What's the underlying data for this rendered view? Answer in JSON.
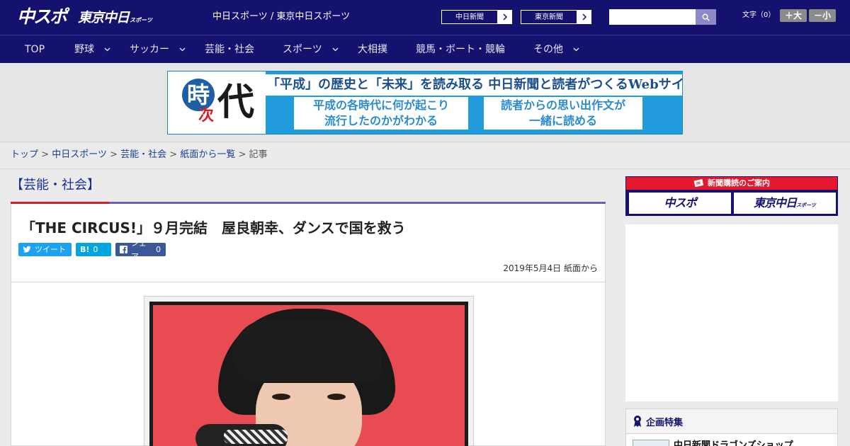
{
  "header": {
    "logo_chuspo": "中スポ",
    "logo_tokyo": "東京中日",
    "logo_tokyo_small": "スポーツ",
    "site_title": "中日スポーツ / 東京中日スポーツ",
    "btn_chunichi": "中日新聞",
    "btn_tokyo": "東京新聞",
    "search_placeholder": "",
    "font_label": "文字（0）",
    "font_large": "＋大",
    "font_small": "－小"
  },
  "nav": {
    "items": [
      {
        "label": "TOP"
      },
      {
        "label": "野球"
      },
      {
        "label": "サッカー"
      },
      {
        "label": "芸能・社会"
      },
      {
        "label": "スポーツ"
      },
      {
        "label": "大相撲"
      },
      {
        "label": "競馬・ボート・競輪"
      },
      {
        "label": "その他"
      }
    ]
  },
  "banner": {
    "logo_ji": "時",
    "logo_tsugi": "次",
    "logo_dai": "代",
    "headline": "「平成」の歴史と「未来」を読み取る 中日新聞と読者がつくるWebサイト",
    "box1_line1": "平成の各時代に何が起こり",
    "box1_line2": "流行したのかがわかる",
    "box2_line1": "読者からの思い出作文が",
    "box2_line2": "一緒に読める"
  },
  "breadcrumb": {
    "items": [
      "トップ",
      "中日スポーツ",
      "芸能・社会",
      "紙面から一覧"
    ],
    "current": "記事",
    "sep": ">"
  },
  "article": {
    "category": "【芸能・社会】",
    "title": "「THE CIRCUS!」９月完結　屋良朝幸、ダンスで国を救う",
    "share_tweet": "ツイート",
    "share_hatena": "B!",
    "share_hatena_count": "0",
    "share_facebook": "シェア",
    "share_facebook_count": "0",
    "date": "2019年5月4日 紙面から"
  },
  "sidebar": {
    "subscribe_label": "新聞購読のご案内",
    "sub_tile_1": "中スポ",
    "sub_tile_2": "東京中日",
    "sub_tile_2_small": "スポーツ",
    "feature_heading": "企画特集",
    "feature_item": "中日新聞ドラゴンズショップ"
  },
  "colors": {
    "brand_navy": "#15116e",
    "accent_red": "#d51f26",
    "banner_blue": "#219bdb"
  }
}
